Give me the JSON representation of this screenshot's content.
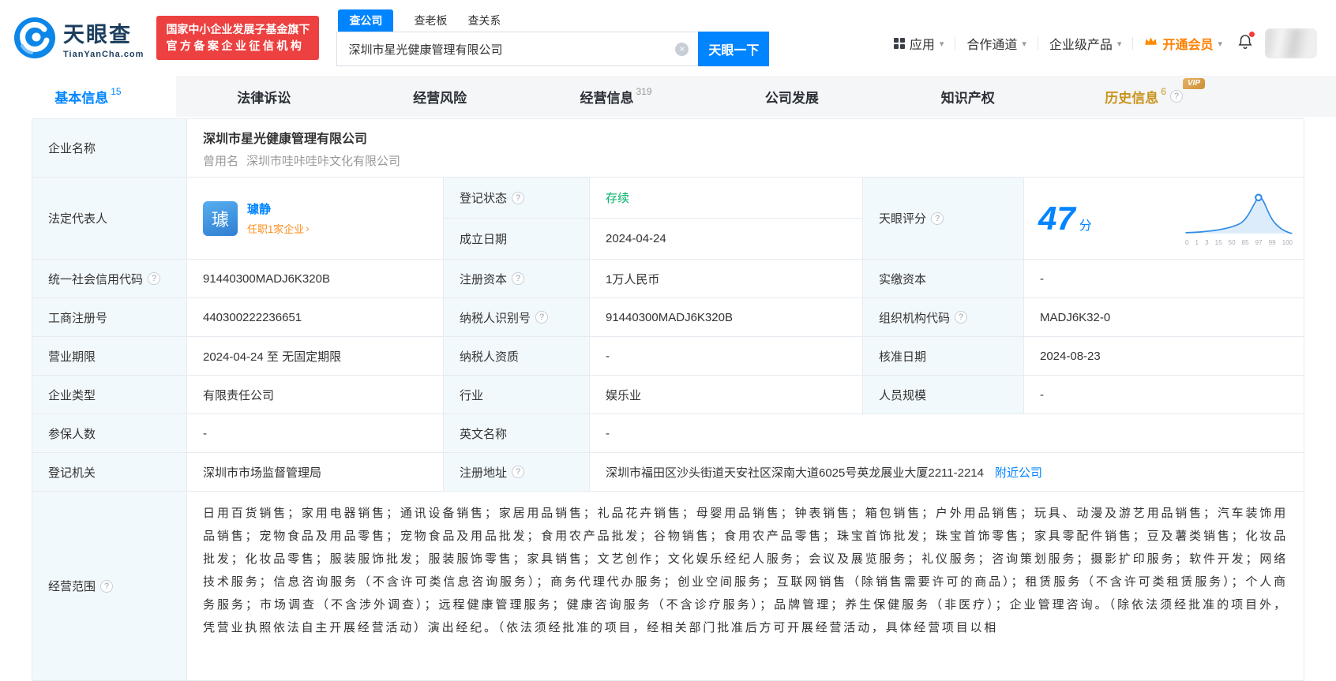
{
  "colors": {
    "primary": "#0084FF",
    "green": "#00B365",
    "orange_link": "#FF8D1A",
    "vip_gold": "#C9941E",
    "badge_red": "#ED4040"
  },
  "icons": {
    "clear": "×",
    "caret": "▾",
    "chevron": "›",
    "help": "?"
  },
  "header": {
    "logo_cn": "天眼查",
    "logo_en": "TianYanCha.com",
    "badge_line1": "国家中小企业发展子基金旗下",
    "badge_line2": "官方备案企业征信机构",
    "search_tabs": [
      {
        "label": "查公司"
      },
      {
        "label": "查老板"
      },
      {
        "label": "查关系"
      }
    ],
    "search_value": "深圳市星光健康管理有限公司",
    "search_button": "天眼一下",
    "nav_app": "应用",
    "nav_coop": "合作通道",
    "nav_product": "企业级产品",
    "nav_vip": "开通会员"
  },
  "tabs": [
    {
      "label": "基本信息",
      "count": "15"
    },
    {
      "label": "法律诉讼",
      "count": ""
    },
    {
      "label": "经营风险",
      "count": ""
    },
    {
      "label": "经营信息",
      "count": "319"
    },
    {
      "label": "公司发展",
      "count": ""
    },
    {
      "label": "知识产权",
      "count": ""
    },
    {
      "label": "历史信息",
      "count": "6",
      "vip": "VIP"
    }
  ],
  "info": {
    "name_label": "企业名称",
    "name": "深圳市星光健康管理有限公司",
    "former_label": "曾用名",
    "former_name": "深圳市哇咔哇咔文化有限公司",
    "legal_rep_label": "法定代表人",
    "legal_rep_avatar_char": "璩",
    "legal_rep_name": "璩静",
    "legal_rep_link": "任职1家企业",
    "reg_status_label": "登记状态",
    "reg_status": "存续",
    "establish_label": "成立日期",
    "establish_date": "2024-04-24",
    "score_label": "天眼评分",
    "score_value": "47",
    "score_unit": "分",
    "score_axis": [
      "0",
      "1",
      "3",
      "15",
      "50",
      "85",
      "97",
      "99",
      "100"
    ],
    "credit_code_label": "统一社会信用代码",
    "credit_code": "91440300MADJ6K320B",
    "reg_capital_label": "注册资本",
    "reg_capital": "1万人民币",
    "paid_capital_label": "实缴资本",
    "paid_capital": "-",
    "reg_no_label": "工商注册号",
    "reg_no": "440300222236651",
    "tax_id_label": "纳税人识别号",
    "tax_id": "91440300MADJ6K320B",
    "org_code_label": "组织机构代码",
    "org_code": "MADJ6K32-0",
    "term_label": "营业期限",
    "term": "2024-04-24 至 无固定期限",
    "tax_quality_label": "纳税人资质",
    "tax_quality": "-",
    "approval_label": "核准日期",
    "approval_date": "2024-08-23",
    "type_label": "企业类型",
    "type": "有限责任公司",
    "industry_label": "行业",
    "industry": "娱乐业",
    "staff_label": "人员规模",
    "staff": "-",
    "insured_label": "参保人数",
    "insured": "-",
    "en_name_label": "英文名称",
    "en_name": "-",
    "authority_label": "登记机关",
    "authority": "深圳市市场监督管理局",
    "address_label": "注册地址",
    "address": "深圳市福田区沙头街道天安社区深南大道6025号英龙展业大厦2211-2214",
    "nearby": "附近公司",
    "scope_label": "经营范围",
    "scope": "日用百货销售；家用电器销售；通讯设备销售；家居用品销售；礼品花卉销售；母婴用品销售；钟表销售；箱包销售；户外用品销售；玩具、动漫及游艺用品销售；汽车装饰用品销售；宠物食品及用品零售；宠物食品及用品批发；食用农产品批发；谷物销售；食用农产品零售；珠宝首饰批发；珠宝首饰零售；家具零配件销售；豆及薯类销售；化妆品批发；化妆品零售；服装服饰批发；服装服饰零售；家具销售；文艺创作；文化娱乐经纪人服务；会议及展览服务；礼仪服务；咨询策划服务；摄影扩印服务；软件开发；网络技术服务；信息咨询服务（不含许可类信息咨询服务）；商务代理代办服务；创业空间服务；互联网销售（除销售需要许可的商品）；租赁服务（不含许可类租赁服务）；个人商务服务；市场调查（不含涉外调查）；远程健康管理服务；健康咨询服务（不含诊疗服务）；品牌管理；养生保健服务（非医疗）；企业管理咨询。（除依法须经批准的项目外，凭营业执照依法自主开展经营活动）演出经纪。（依法须经批准的项目，经相关部门批准后方可开展经营活动，具体经营项目以相"
  }
}
